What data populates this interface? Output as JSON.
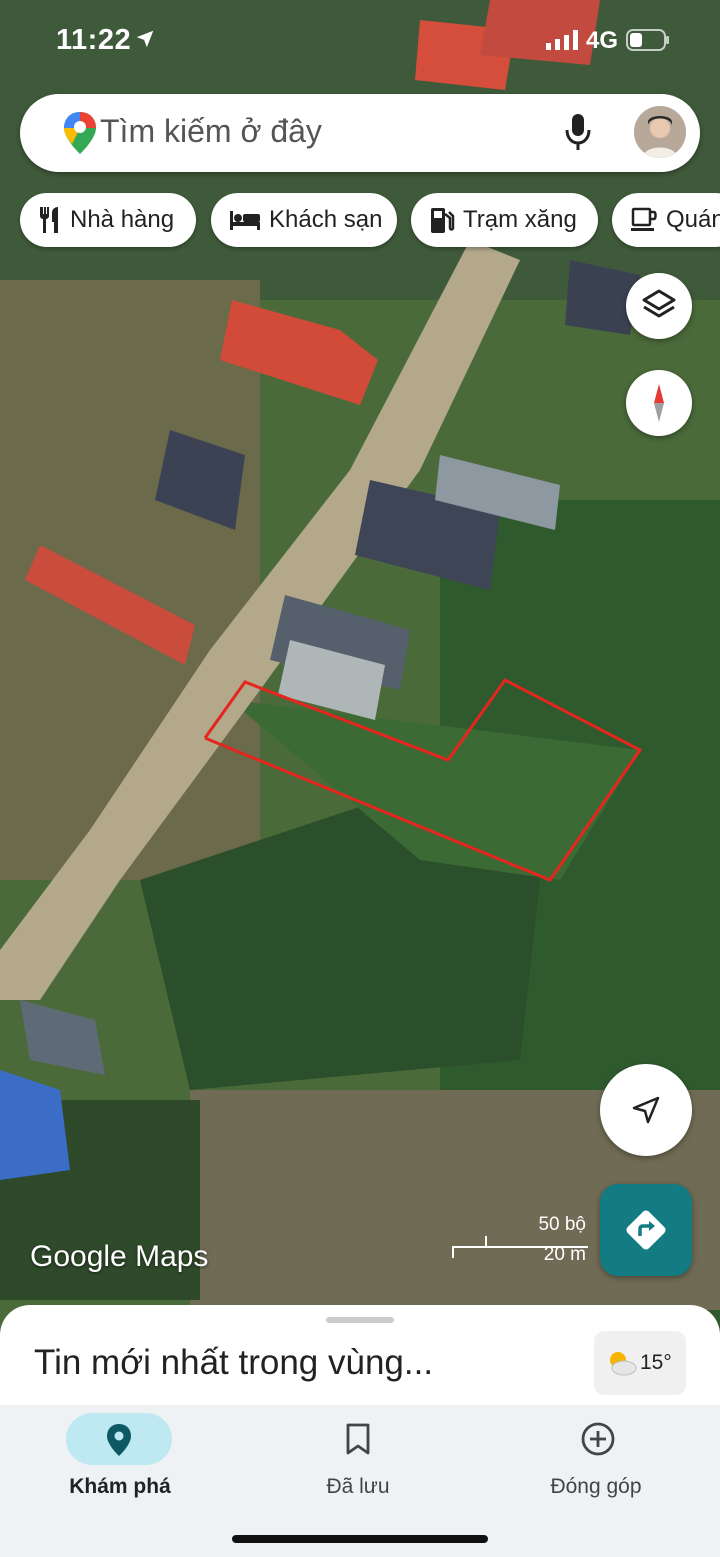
{
  "status_bar": {
    "time": "11:22",
    "network": "4G"
  },
  "search": {
    "placeholder": "Tìm kiếm ở đây",
    "logo_icon": "google-maps-pin-icon",
    "mic_icon": "mic-icon"
  },
  "chips": [
    {
      "label": "Nhà hàng",
      "icon": "restaurant-icon"
    },
    {
      "label": "Khách sạn",
      "icon": "hotel-icon"
    },
    {
      "label": "Trạm xăng",
      "icon": "gas-station-icon"
    },
    {
      "label": "Quán",
      "icon": "coffee-icon"
    }
  ],
  "map": {
    "attribution": "Google Maps",
    "scale_imperial": "50 bộ",
    "scale_metric": "20 m",
    "boundary_color": "#e4261f"
  },
  "sheet": {
    "title": "Tin mới nhất trong vùng...",
    "weather": "15°"
  },
  "nav": [
    {
      "label": "Khám phá",
      "icon": "explore-pin-icon",
      "active": true
    },
    {
      "label": "Đã lưu",
      "icon": "bookmark-icon",
      "active": false
    },
    {
      "label": "Đóng góp",
      "icon": "add-circle-icon",
      "active": false
    }
  ],
  "colors": {
    "accent": "#137b82",
    "active_pill": "#bfe9f2"
  }
}
